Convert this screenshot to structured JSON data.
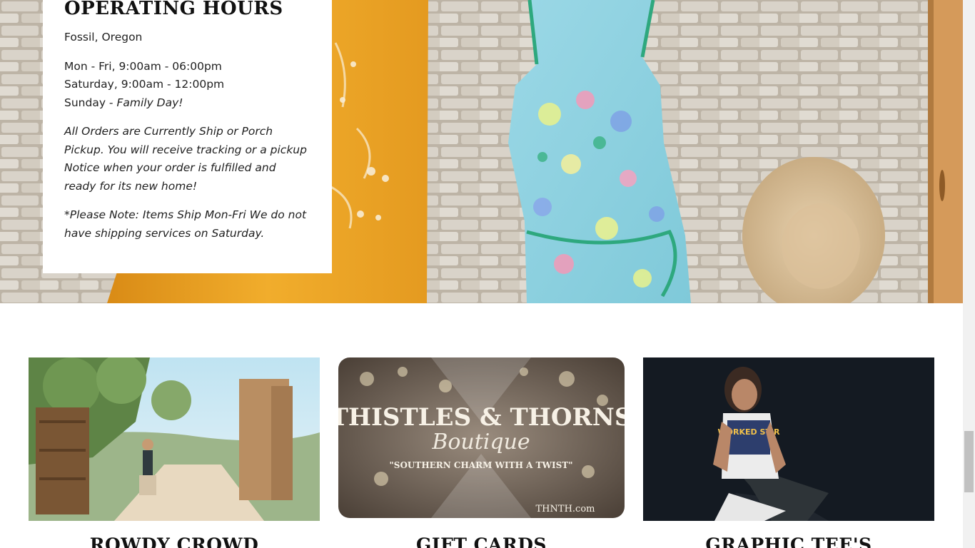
{
  "hours": {
    "title": "OPERATING HOURS",
    "location": "Fossil, Oregon",
    "weekday": "Mon - Fri, 9:00am - 06:00pm",
    "saturday": "Saturday, 9:00am - 12:00pm",
    "sunday_prefix": "Sunday - ",
    "sunday_note": "Family Day!",
    "orders_note": "All Orders are Currently Ship or Porch Pickup. You will receive tracking or a pickup Notice when your order is fulfilled and ready for its new home!",
    "shipping_note": "*Please Note: Items Ship Mon-Fri We do not have shipping services on Saturday."
  },
  "collections": [
    {
      "title": "ROWDY CROWD"
    },
    {
      "title": "GIFT CARDS",
      "card_brand": "THISTLES & THORNS",
      "card_script": "Boutique",
      "card_tagline": "\"SOUTHERN CHARM WITH A TWIST\"",
      "card_url": "THNTH.com"
    },
    {
      "title": "GRAPHIC TEE'S",
      "shirt_text": "WORKED STIR"
    }
  ],
  "colors": {
    "brick": "#cdc6ba",
    "mustard": "#e9a225",
    "dress": "#8fd3e0",
    "background": "#ffffff"
  }
}
